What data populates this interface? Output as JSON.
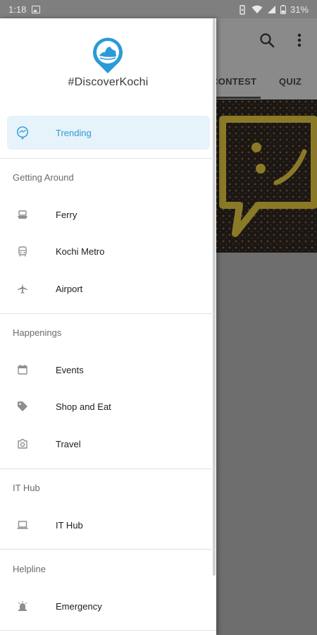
{
  "status_bar": {
    "time": "1:18",
    "battery": "31%"
  },
  "background": {
    "tabs": [
      "CONTEST",
      "QUIZ"
    ]
  },
  "drawer": {
    "app_title": "#DiscoverKochi",
    "trending": {
      "label": "Trending",
      "icon": "trending-icon"
    },
    "sections": [
      {
        "title": "Getting Around",
        "items": [
          {
            "label": "Ferry",
            "icon": "ferry-icon"
          },
          {
            "label": "Kochi Metro",
            "icon": "metro-icon"
          },
          {
            "label": "Airport",
            "icon": "airplane-icon"
          }
        ]
      },
      {
        "title": "Happenings",
        "items": [
          {
            "label": "Events",
            "icon": "calendar-icon"
          },
          {
            "label": "Shop and Eat",
            "icon": "tag-icon"
          },
          {
            "label": "Travel",
            "icon": "camera-icon"
          }
        ]
      },
      {
        "title": "IT Hub",
        "items": [
          {
            "label": "IT Hub",
            "icon": "laptop-icon"
          }
        ]
      },
      {
        "title": "Helpline",
        "items": [
          {
            "label": "Emergency",
            "icon": "alarm-icon"
          }
        ]
      }
    ]
  },
  "colors": {
    "accent": "#2e9bd6",
    "selected_bg": "#e6f3fb",
    "scrim": "#6e6e6e"
  }
}
